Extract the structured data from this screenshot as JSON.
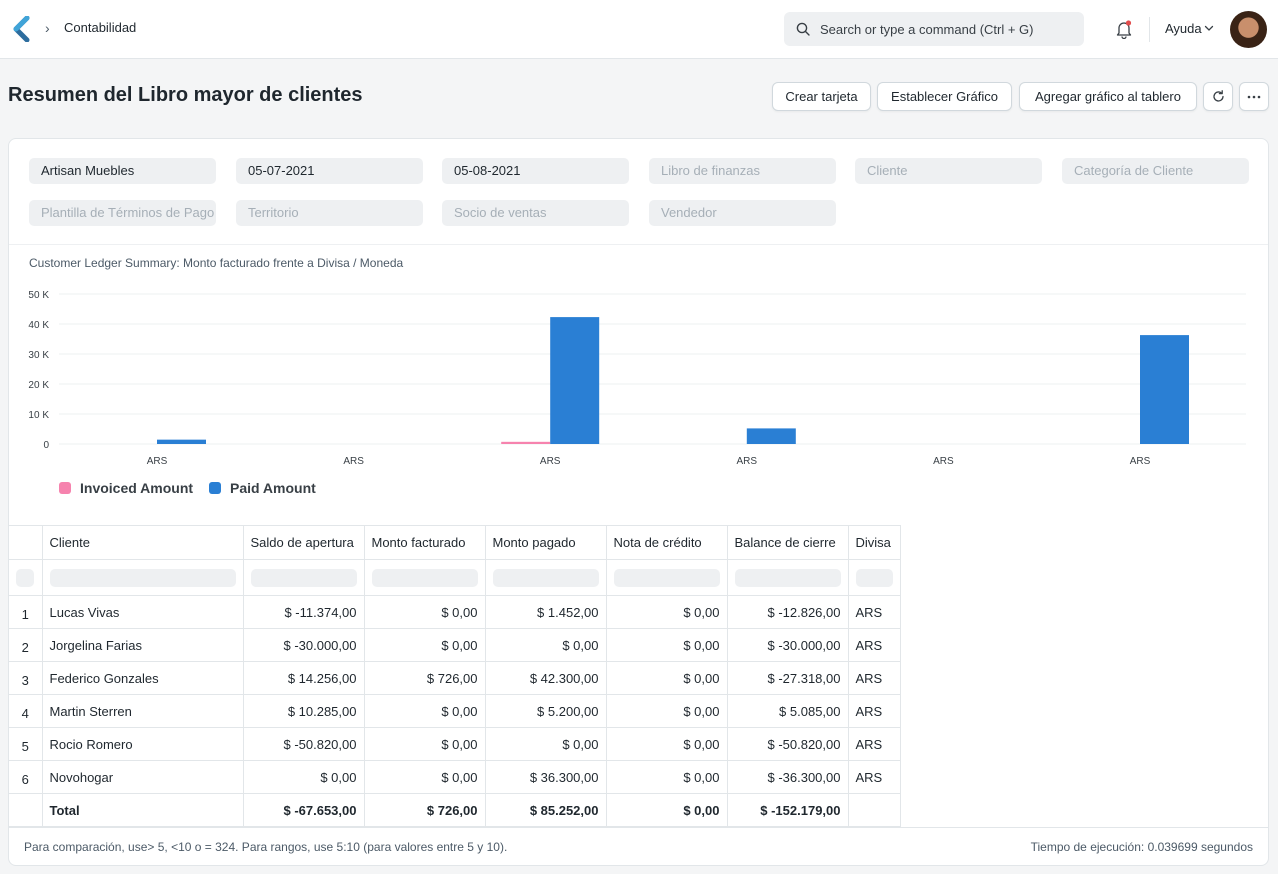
{
  "navbar": {
    "breadcrumb": "Contabilidad",
    "search_placeholder": "Search or type a command (Ctrl + G)",
    "help_label": "Ayuda"
  },
  "page": {
    "title": "Resumen del Libro mayor de clientes",
    "buttons": {
      "create_card": "Crear tarjeta",
      "set_chart": "Establecer Gráfico",
      "add_to_dashboard": "Agregar gráfico al tablero"
    }
  },
  "filters": {
    "company": "Artisan Muebles",
    "from_date": "05-07-2021",
    "to_date": "05-08-2021",
    "finance_book": "Libro de finanzas",
    "customer": "Cliente",
    "customer_group": "Categoría de Cliente",
    "payment_terms": "Plantilla de Términos de Pago",
    "territory": "Territorio",
    "sales_partner": "Socio de ventas",
    "sales_person": "Vendedor"
  },
  "colors": {
    "invoiced": "#f683ae",
    "paid": "#2a7fd4"
  },
  "chart_data": {
    "type": "bar",
    "title": "Customer Ledger Summary: Monto facturado frente a Divisa / Moneda",
    "categories": [
      "ARS",
      "ARS",
      "ARS",
      "ARS",
      "ARS",
      "ARS"
    ],
    "series": [
      {
        "name": "Invoiced Amount",
        "values": [
          0,
          0,
          726,
          0,
          0,
          0
        ]
      },
      {
        "name": "Paid Amount",
        "values": [
          1452,
          0,
          42300,
          5200,
          0,
          36300
        ]
      }
    ],
    "y_ticks": [
      0,
      10000,
      20000,
      30000,
      40000,
      50000
    ],
    "y_tick_labels": [
      "0",
      "10 K",
      "20 K",
      "30 K",
      "40 K",
      "50 K"
    ],
    "ylim": [
      0,
      50000
    ],
    "grid": true,
    "legend": "bottom-left"
  },
  "table": {
    "columns": [
      "Cliente",
      "Saldo de apertura",
      "Monto facturado",
      "Monto pagado",
      "Nota de crédito",
      "Balance de cierre",
      "Divisa"
    ],
    "rows": [
      {
        "n": "1",
        "cliente": "Lucas Vivas",
        "apertura": "$ -11.374,00",
        "facturado": "$ 0,00",
        "pagado": "$ 1.452,00",
        "nota": "$ 0,00",
        "cierre": "$ -12.826,00",
        "divisa": "ARS"
      },
      {
        "n": "2",
        "cliente": "Jorgelina Farias",
        "apertura": "$ -30.000,00",
        "facturado": "$ 0,00",
        "pagado": "$ 0,00",
        "nota": "$ 0,00",
        "cierre": "$ -30.000,00",
        "divisa": "ARS"
      },
      {
        "n": "3",
        "cliente": "Federico Gonzales",
        "apertura": "$ 14.256,00",
        "facturado": "$ 726,00",
        "pagado": "$ 42.300,00",
        "nota": "$ 0,00",
        "cierre": "$ -27.318,00",
        "divisa": "ARS"
      },
      {
        "n": "4",
        "cliente": "Martin Sterren",
        "apertura": "$ 10.285,00",
        "facturado": "$ 0,00",
        "pagado": "$ 5.200,00",
        "nota": "$ 0,00",
        "cierre": "$ 5.085,00",
        "divisa": "ARS"
      },
      {
        "n": "5",
        "cliente": "Rocio Romero",
        "apertura": "$ -50.820,00",
        "facturado": "$ 0,00",
        "pagado": "$ 0,00",
        "nota": "$ 0,00",
        "cierre": "$ -50.820,00",
        "divisa": "ARS"
      },
      {
        "n": "6",
        "cliente": "Novohogar",
        "apertura": "$ 0,00",
        "facturado": "$ 0,00",
        "pagado": "$ 36.300,00",
        "nota": "$ 0,00",
        "cierre": "$ -36.300,00",
        "divisa": "ARS"
      }
    ],
    "total": {
      "label": "Total",
      "apertura": "$ -67.653,00",
      "facturado": "$ 726,00",
      "pagado": "$ 85.252,00",
      "nota": "$ 0,00",
      "cierre": "$ -152.179,00"
    }
  },
  "footer": {
    "hint": "Para comparación, use> 5, <10 o = 324. Para rangos, use 5:10 (para valores entre 5 y 10).",
    "execution_time": "Tiempo de ejecución: 0.039699 segundos"
  }
}
